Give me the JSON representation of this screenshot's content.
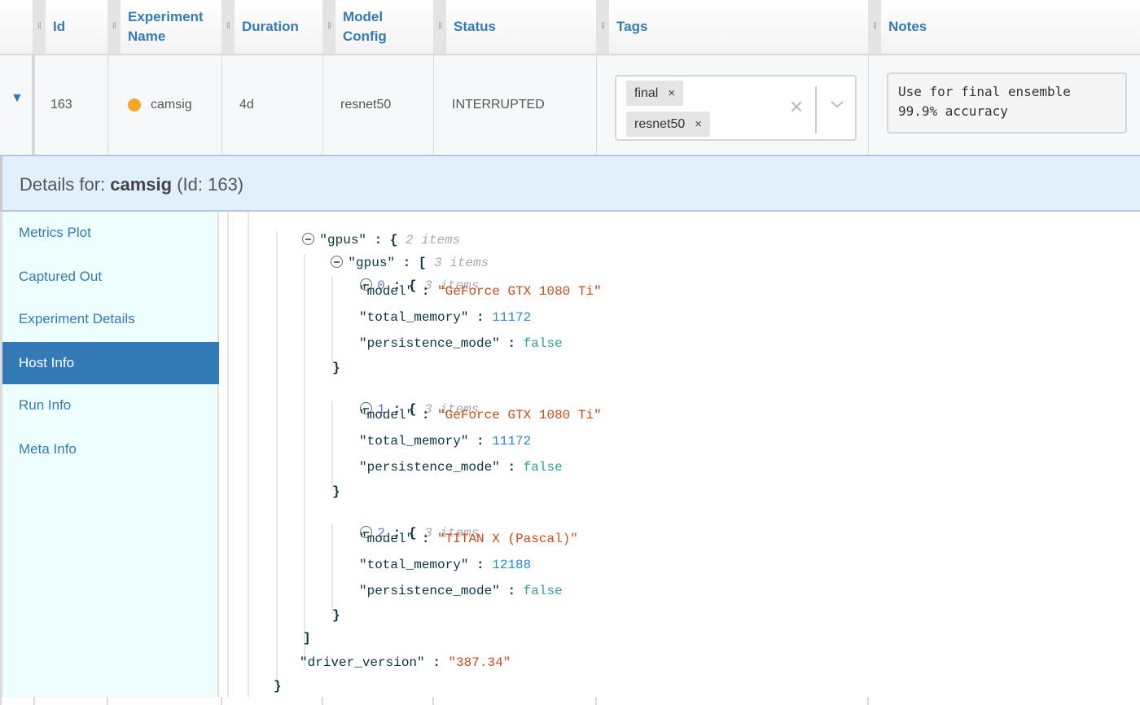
{
  "table": {
    "columns": [
      {
        "label": "Id"
      },
      {
        "label": "Experiment\nName"
      },
      {
        "label": "Duration"
      },
      {
        "label": "Model\nConfig"
      },
      {
        "label": "Status"
      },
      {
        "label": "Tags"
      },
      {
        "label": "Notes"
      }
    ],
    "row": {
      "expand_icon": "▼",
      "id": "163",
      "status_dot_color": "#f6a623",
      "experiment_name": "camsig",
      "duration": "4d",
      "model_config": "resnet50",
      "status": "INTERRUPTED",
      "tags": [
        {
          "label": "final",
          "remove": "×"
        },
        {
          "label": "resnet50",
          "remove": "×"
        }
      ],
      "tags_clear": "✕",
      "tags_dropdown": "⌄",
      "notes": "Use for final ensemble\n99.9% accuracy"
    }
  },
  "details": {
    "prefix": "Details for: ",
    "name": "camsig",
    "suffix": " (Id: 163)"
  },
  "sidebar": {
    "items": [
      {
        "label": "Metrics Plot",
        "active": false
      },
      {
        "label": "Captured Out",
        "active": false
      },
      {
        "label": "Experiment Details",
        "active": false
      },
      {
        "label": "Host Info",
        "active": true
      },
      {
        "label": "Run Info",
        "active": false
      },
      {
        "label": "Meta Info",
        "active": false
      }
    ]
  },
  "json_view": {
    "root_key": "\"gpus\"",
    "root_meta": "2 items",
    "array_key": "\"gpus\"",
    "array_meta": "3 items",
    "gpus": [
      {
        "index": "0",
        "meta": "3 items",
        "model": "\"GeForce GTX 1080 Ti\"",
        "total_memory": "11172",
        "persistence_mode": "false"
      },
      {
        "index": "1",
        "meta": "3 items",
        "model": "\"GeForce GTX 1080 Ti\"",
        "total_memory": "11172",
        "persistence_mode": "false"
      },
      {
        "index": "2",
        "meta": "3 items",
        "model": "\"TITAN X (Pascal)\"",
        "total_memory": "12188",
        "persistence_mode": "false"
      }
    ],
    "keys": {
      "model": "\"model\"",
      "total_memory": "\"total_memory\"",
      "persistence_mode": "\"persistence_mode\"",
      "driver_version": "\"driver_version\""
    },
    "driver_version": "\"387.34\""
  }
}
